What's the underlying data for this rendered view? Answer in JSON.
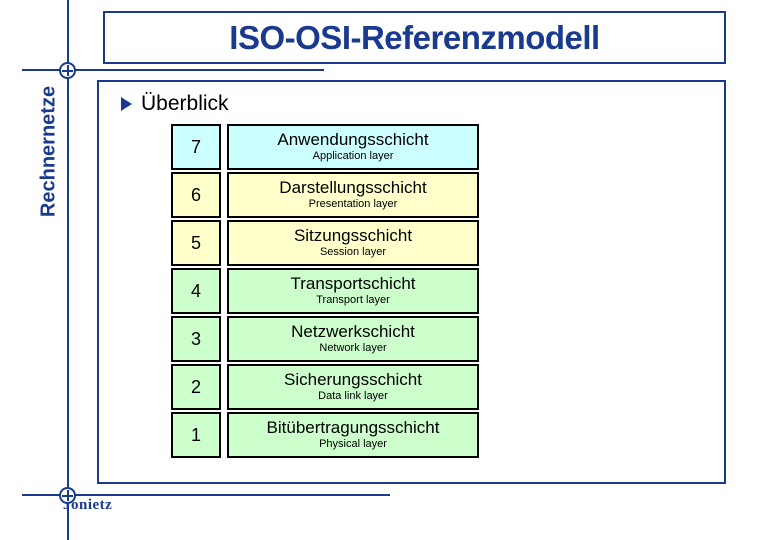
{
  "slide": {
    "title": "ISO-OSI-Referenzmodell",
    "sidebar_title": "Rechnernetze",
    "footer_author": "Jonietz",
    "overview_heading": "Überblick",
    "bullet_icon": "triangle-right-icon",
    "colors": {
      "brand_blue": "#1a3a8f",
      "layer_cyan": "#ccffff",
      "layer_yellow": "#ffffcc",
      "layer_green": "#ccffcc",
      "border_black": "#000000"
    }
  },
  "layers": [
    {
      "number": "7",
      "name_de": "Anwendungsschicht",
      "name_en": "Application layer",
      "color": "#ccffff"
    },
    {
      "number": "6",
      "name_de": "Darstellungsschicht",
      "name_en": "Presentation layer",
      "color": "#ffffcc"
    },
    {
      "number": "5",
      "name_de": "Sitzungsschicht",
      "name_en": "Session layer",
      "color": "#ffffcc"
    },
    {
      "number": "4",
      "name_de": "Transportschicht",
      "name_en": "Transport layer",
      "color": "#ccffcc"
    },
    {
      "number": "3",
      "name_de": "Netzwerkschicht",
      "name_en": "Network layer",
      "color": "#ccffcc"
    },
    {
      "number": "2",
      "name_de": "Sicherungsschicht",
      "name_en": "Data link layer",
      "color": "#ccffcc"
    },
    {
      "number": "1",
      "name_de": "Bitübertragungsschicht",
      "name_en": "Physical layer",
      "color": "#ccffcc"
    }
  ]
}
